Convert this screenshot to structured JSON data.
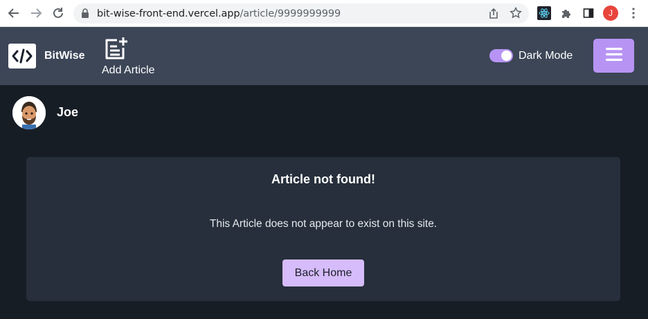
{
  "browser": {
    "url_host": "bit-wise-front-end.vercel.app",
    "url_path": "/article/9999999999",
    "profile_initial": "J"
  },
  "header": {
    "brand": "BitWise",
    "add_article_label": "Add Article",
    "dark_mode_label": "Dark Mode",
    "dark_mode_on": true
  },
  "user": {
    "name": "Joe"
  },
  "card": {
    "title": "Article not found!",
    "message": "This Article does not appear to exist on this site.",
    "button_label": "Back Home"
  },
  "colors": {
    "accent": "#b794f4",
    "button": "#d6bcfa",
    "header_bg": "#3c4657",
    "page_bg": "#171d25",
    "card_bg": "#262f3b"
  }
}
